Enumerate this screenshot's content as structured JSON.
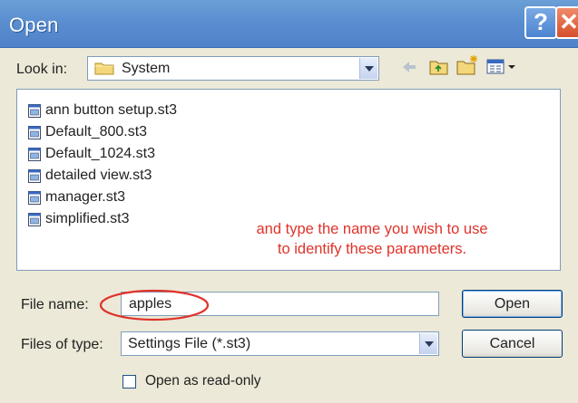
{
  "window": {
    "title": "Open",
    "help_glyph": "?",
    "close_glyph": "✕"
  },
  "lookin": {
    "label": "Look in:",
    "value": "System",
    "icon": "folder-icon",
    "toolbar_icons": [
      "back-arrow-icon",
      "up-one-level-icon",
      "new-folder-icon",
      "view-menu-icon"
    ]
  },
  "files": [
    {
      "name": "ann button setup.st3",
      "icon": "settings-file-icon"
    },
    {
      "name": "Default_800.st3",
      "icon": "settings-file-icon"
    },
    {
      "name": "Default_1024.st3",
      "icon": "settings-file-icon"
    },
    {
      "name": "detailed view.st3",
      "icon": "settings-file-icon"
    },
    {
      "name": "manager.st3",
      "icon": "settings-file-icon"
    },
    {
      "name": "simplified.st3",
      "icon": "settings-file-icon"
    }
  ],
  "annotation": {
    "line1": "and type the name you wish to use",
    "line2": "to identify these parameters.",
    "color": "#e0322a"
  },
  "filename": {
    "label": "File name:",
    "value": "apples"
  },
  "filetype": {
    "label": "Files of type:",
    "value": "Settings File (*.st3)"
  },
  "buttons": {
    "open": "Open",
    "cancel": "Cancel"
  },
  "readonly": {
    "label": "Open as read-only",
    "checked": false
  },
  "colors": {
    "titlebar": "#5a8ed0",
    "dialog_bg": "#ece9d8",
    "annotation_red": "#e0322a"
  }
}
